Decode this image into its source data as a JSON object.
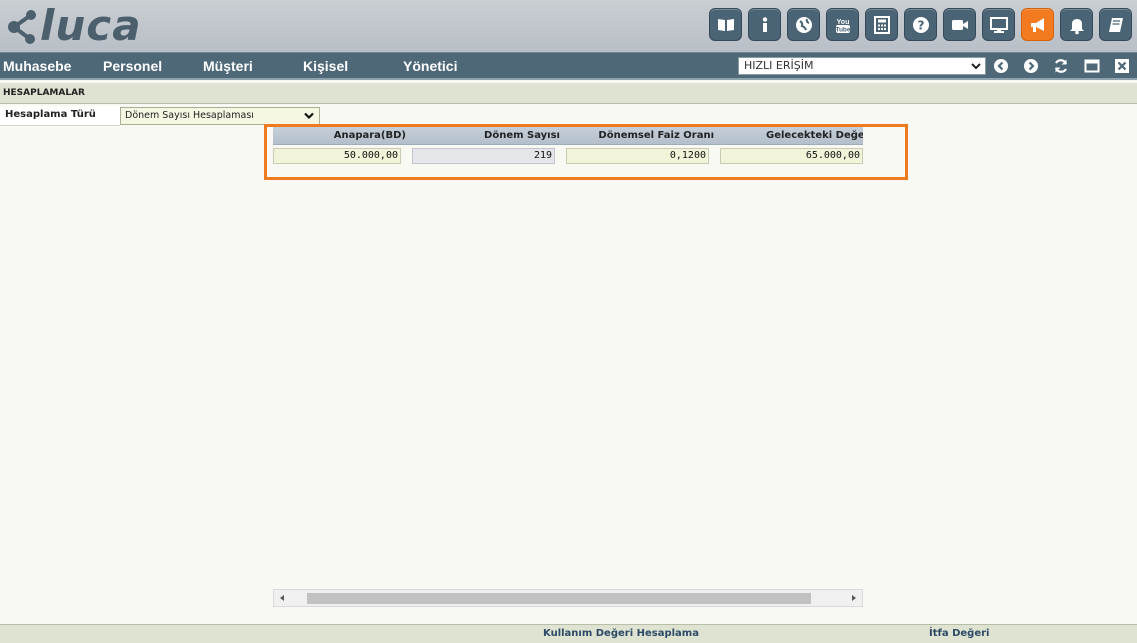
{
  "app": {
    "logo_text": "luca"
  },
  "toolbar": {
    "icons": [
      {
        "name": "book-open-icon"
      },
      {
        "name": "info-icon"
      },
      {
        "name": "globe-icon"
      },
      {
        "name": "youtube-icon",
        "label": "You Tube"
      },
      {
        "name": "calculator-icon"
      },
      {
        "name": "help-icon"
      },
      {
        "name": "video-camera-icon"
      },
      {
        "name": "monitor-icon"
      },
      {
        "name": "megaphone-icon",
        "active": true
      },
      {
        "name": "bell-icon"
      },
      {
        "name": "notebook-icon"
      }
    ],
    "active_color": "#f37a1f"
  },
  "menu": {
    "items": [
      "Muhasebe",
      "Personel",
      "Müşteri",
      "Kişisel",
      "Yönetici"
    ],
    "quick_access": "HIZLI ERİŞİM"
  },
  "section": {
    "title": "HESAPLAMALAR",
    "type_label": "Hesaplama Türü",
    "type_value": "Dönem Sayısı Hesaplaması"
  },
  "grid": {
    "columns": [
      "Anapara(BD)",
      "Dönem Sayısı",
      "Dönemsel Faiz Oranı",
      "Gelecekteki Değer"
    ],
    "row": [
      "50.000,00",
      "219",
      "0,1200",
      "65.000,00"
    ],
    "highlight_color": "#f07b1e"
  },
  "footer": {
    "links": [
      "Kullanım Değeri Hesaplama",
      "İtfa Değeri"
    ]
  }
}
